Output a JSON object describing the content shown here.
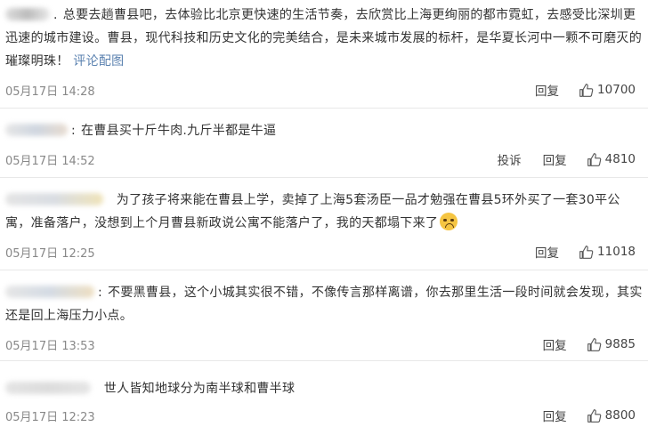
{
  "comments": [
    {
      "text": "总要去趟曹县吧，去体验比北京更快速的生活节奏，去欣赏比上海更绚丽的都市霓虹，去感受比深圳更迅速的城市建设。曹县，现代科技和历史文化的完美结合，是未来城市发展的标杆，是华夏长河中一颗不可磨灭的璀璨明珠！",
      "link": "评论配图",
      "time": "05月17日 14:28",
      "reply": "回复",
      "likes": "10700"
    },
    {
      "text": "在曹县买十斤牛肉.九斤半都是牛逼",
      "time": "05月17日 14:52",
      "report": "投诉",
      "reply": "回复",
      "likes": "4810"
    },
    {
      "text": "为了孩子将来能在曹县上学，卖掉了上海5套汤臣一品才勉强在曹县5环外买了一套30平公寓，准备落户，没想到上个月曹县新政说公寓不能落户了，我的天都塌下来了",
      "emoji": "crying-face-emoji",
      "time": "05月17日 12:25",
      "reply": "回复",
      "likes": "11018"
    },
    {
      "text": "不要黑曹县，这个小城其实很不错，不像传言那样离谱，你去那里生活一段时间就会发现，其实还是回上海压力小点。",
      "time": "05月17日 13:53",
      "reply": "回复",
      "likes": "9885"
    },
    {
      "text": "世人皆知地球分为南半球和曹半球",
      "time": "05月17日 12:23",
      "reply": "回复",
      "likes": "8800"
    }
  ],
  "colors": {
    "link": "#5b82b0",
    "time": "#888888",
    "divider": "#e8e8e8"
  }
}
